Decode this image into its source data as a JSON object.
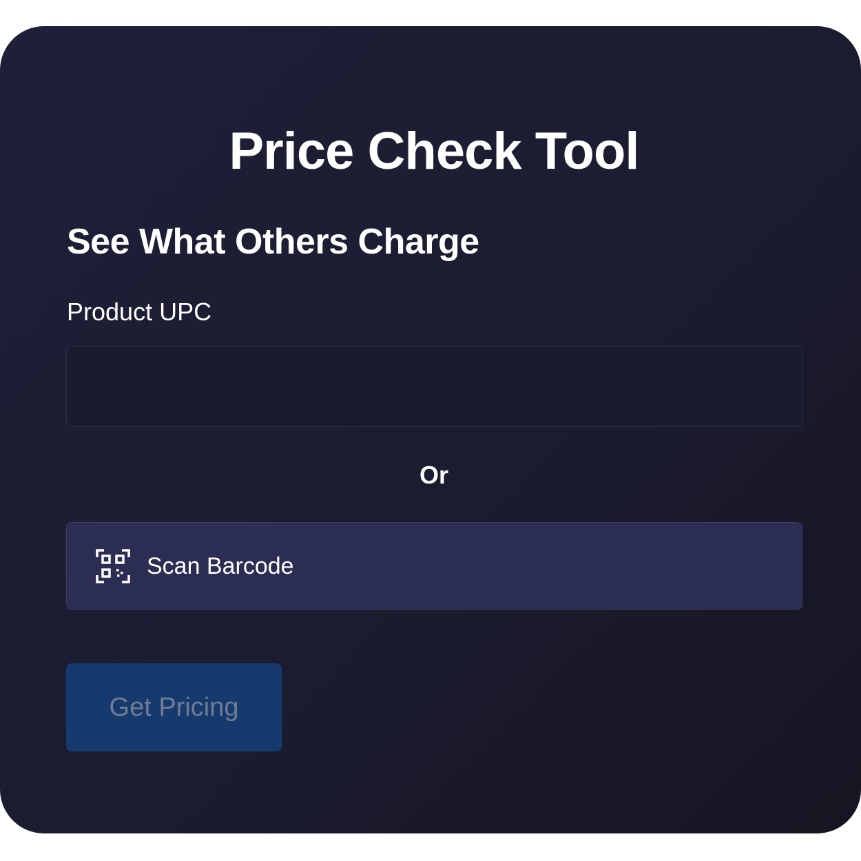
{
  "header": {
    "title": "Price Check Tool",
    "subtitle": "See What Others Charge"
  },
  "form": {
    "upc_label": "Product UPC",
    "upc_value": "",
    "upc_placeholder": "",
    "or_divider": "Or",
    "scan_button_label": "Scan Barcode",
    "scan_icon": "qr-code-scan-icon",
    "submit_label": "Get Pricing",
    "submit_disabled": true
  },
  "colors": {
    "card_background": "#1c1c30",
    "scan_button_background": "#2c2d52",
    "submit_background": "#173a6e",
    "submit_text": "#6f7c94"
  }
}
